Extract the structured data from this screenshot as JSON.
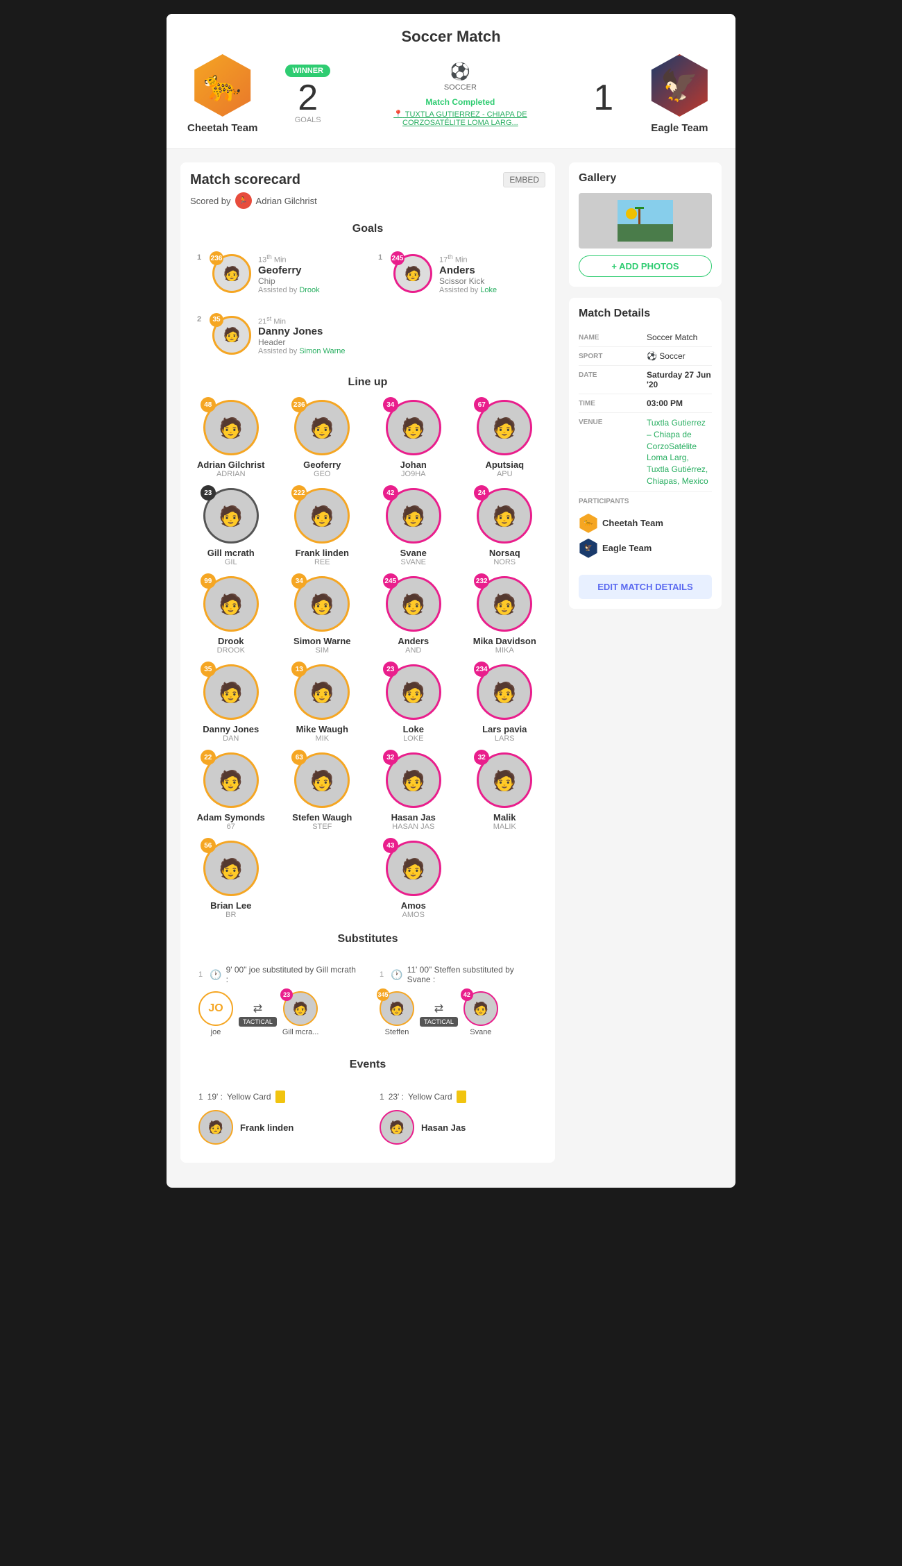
{
  "header": {
    "title": "Soccer Match",
    "cheetah_team": "Cheetah Team",
    "eagle_team": "Eagle Team",
    "winner_label": "WINNER",
    "cheetah_score": "2",
    "eagle_score": "1",
    "goals_label": "GOALS",
    "sport": "SOCCER",
    "status": "Match Completed",
    "venue": "TUXTLA GUTIERREZ - CHIAPA DE CORZOSATÉLITE LOMA LARG..."
  },
  "scorecard": {
    "title": "Match scorecard",
    "embed_label": "EMBED",
    "scored_by_label": "Scored by",
    "scorer": "Adrian Gilchrist"
  },
  "goals": {
    "title": "Goals",
    "items": [
      {
        "team_num": "1",
        "position": "1",
        "min": "13",
        "min_sup": "th",
        "player": "Geoferry",
        "type": "Chip",
        "assist_label": "Assisted by",
        "assist": "Drook",
        "border": "orange"
      },
      {
        "team_num": "1",
        "position": "1",
        "min": "17",
        "min_sup": "th",
        "player": "Anders",
        "type": "Scissor Kick",
        "assist_label": "Assisted by",
        "assist": "Loke",
        "border": "pink"
      },
      {
        "team_num": "2",
        "position": "2",
        "min": "21",
        "min_sup": "st",
        "player": "Danny Jones",
        "type": "Header",
        "assist_label": "Assisted by",
        "assist": "Simon Warne",
        "border": "orange"
      }
    ]
  },
  "lineup": {
    "title": "Line up",
    "players": [
      {
        "name": "Adrian Gilchrist",
        "code": "ADRIAN",
        "num": "48",
        "border": "orange"
      },
      {
        "name": "Geoferry",
        "code": "GEO",
        "num": "236",
        "border": "orange"
      },
      {
        "name": "Johan",
        "code": "JO9HA",
        "num": "34",
        "border": "pink"
      },
      {
        "name": "Aputsiaq",
        "code": "APU",
        "num": "67",
        "border": "pink"
      },
      {
        "name": "Gill mcrath",
        "code": "GIL",
        "num": "23",
        "border": "dark"
      },
      {
        "name": "Frank linden",
        "code": "REE",
        "num": "222",
        "border": "orange"
      },
      {
        "name": "Svane",
        "code": "SVANE",
        "num": "42",
        "border": "pink"
      },
      {
        "name": "Norsaq",
        "code": "NORS",
        "num": "24",
        "border": "pink"
      },
      {
        "name": "Drook",
        "code": "DROOK",
        "num": "99",
        "border": "orange"
      },
      {
        "name": "Simon Warne",
        "code": "SIM",
        "num": "34",
        "border": "orange"
      },
      {
        "name": "Anders",
        "code": "AND",
        "num": "245",
        "border": "pink"
      },
      {
        "name": "Mika Davidson",
        "code": "MIKA",
        "num": "232",
        "border": "pink"
      },
      {
        "name": "Danny Jones",
        "code": "DAN",
        "num": "35",
        "border": "orange"
      },
      {
        "name": "Mike Waugh",
        "code": "MIK",
        "num": "13",
        "border": "orange"
      },
      {
        "name": "Loke",
        "code": "LOKE",
        "num": "23",
        "border": "pink"
      },
      {
        "name": "Lars pavia",
        "code": "LARS",
        "num": "234",
        "border": "pink"
      },
      {
        "name": "Adam Symonds",
        "code": "67",
        "num": "22",
        "border": "orange"
      },
      {
        "name": "Stefen Waugh",
        "code": "STEF",
        "num": "63",
        "border": "orange"
      },
      {
        "name": "Hasan Jas",
        "code": "HASAN JAS",
        "num": "32",
        "border": "pink"
      },
      {
        "name": "Malik",
        "code": "MALIK",
        "num": "32",
        "border": "pink"
      },
      {
        "name": "Brian Lee",
        "code": "BR",
        "num": "56",
        "border": "orange"
      },
      {
        "name": "",
        "code": "",
        "num": "",
        "border": ""
      },
      {
        "name": "Amos",
        "code": "AMOS",
        "num": "43",
        "border": "pink"
      },
      {
        "name": "",
        "code": "",
        "num": "",
        "border": ""
      }
    ]
  },
  "substitutes": {
    "title": "Substitutes",
    "items": [
      {
        "team_num": "1",
        "time": "9' 00\"",
        "description": "joe substituted by Gill mcrath :",
        "out_player": "joe",
        "out_initials": "JO",
        "out_num": "",
        "in_player": "Gill mcra...",
        "in_num": "23",
        "tactical": "TACTICAL"
      },
      {
        "team_num": "1",
        "time": "11' 00\"",
        "description": "Steffen substituted by Svane :",
        "out_player": "Steffen",
        "out_num": "345",
        "in_player": "Svane",
        "in_num": "42",
        "tactical": "TACTICAL"
      }
    ]
  },
  "events": {
    "title": "Events",
    "items": [
      {
        "team_num": "1",
        "time": "19'",
        "type": "Yellow Card",
        "player": "Frank linden",
        "border": "orange"
      },
      {
        "team_num": "1",
        "time": "23'",
        "type": "Yellow Card",
        "player": "Hasan Jas",
        "border": "pink"
      }
    ]
  },
  "gallery": {
    "title": "Gallery",
    "add_photos_label": "+ ADD PHOTOS"
  },
  "match_details": {
    "title": "Match Details",
    "rows": [
      {
        "label": "NAME",
        "value": "Soccer Match",
        "type": "normal"
      },
      {
        "label": "SPORT",
        "value": "⚽ Soccer",
        "type": "normal"
      },
      {
        "label": "DATE",
        "value": "Saturday 27 Jun '20",
        "type": "bold"
      },
      {
        "label": "TIME",
        "value": "03:00 PM",
        "type": "bold"
      },
      {
        "label": "VENUE",
        "value": "Tuxtla Gutierrez – Chiapa de CorzoSatélite Loma Larg, Tuxtla Gutiérrez, Chiapas, Mexico",
        "type": "link"
      }
    ],
    "participants_label": "PARTICIPANTS",
    "participants": [
      {
        "name": "Cheetah Team",
        "team": "cheetah"
      },
      {
        "name": "Eagle Team",
        "team": "eagle"
      }
    ],
    "edit_button": "EDIT MATCH DETAILS"
  }
}
